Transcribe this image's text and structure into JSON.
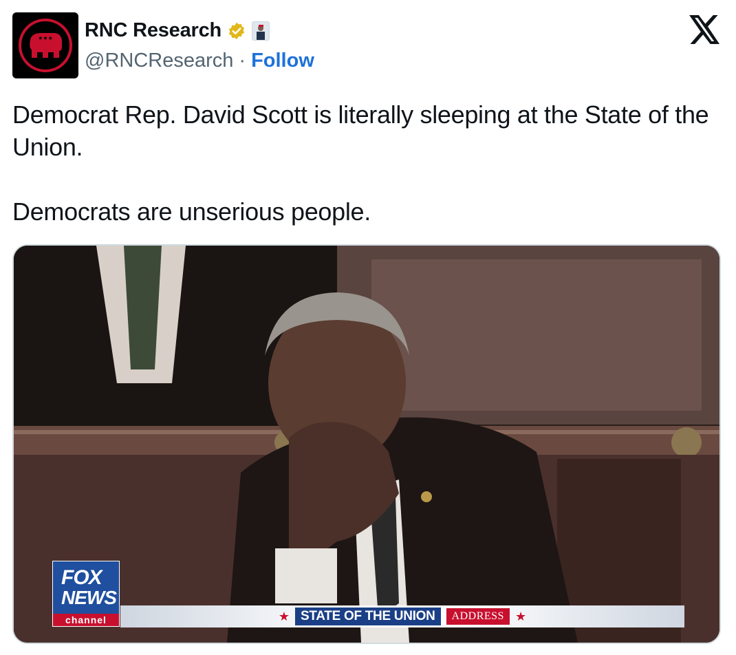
{
  "author": {
    "display_name": "RNC Research",
    "handle": "@RNCResearch",
    "separator": "·",
    "follow_label": "Follow",
    "avatar_icon": "rnc-elephant-logo",
    "verified_icon": "gold-verified-badge",
    "verified_color": "#e2b719",
    "affiliation_icon": "affiliate-badge"
  },
  "platform_icon": "x-logo",
  "tweet": {
    "paragraphs": [
      "Democrat Rep. David Scott is literally sleeping at the State of the Union.",
      "Democrats are unserious people."
    ]
  },
  "media": {
    "network_logo_top": "FOX",
    "network_logo_mid": "NEWS",
    "network_logo_bottom": "channel",
    "banner_main": "STATE OF THE UNION",
    "banner_address": "ADDRESS"
  },
  "colors": {
    "follow_link": "#1d72d9",
    "text_primary": "#0f1419",
    "text_secondary": "#536471",
    "rnc_red": "#c8102e",
    "fox_blue": "#1f4f9e"
  }
}
